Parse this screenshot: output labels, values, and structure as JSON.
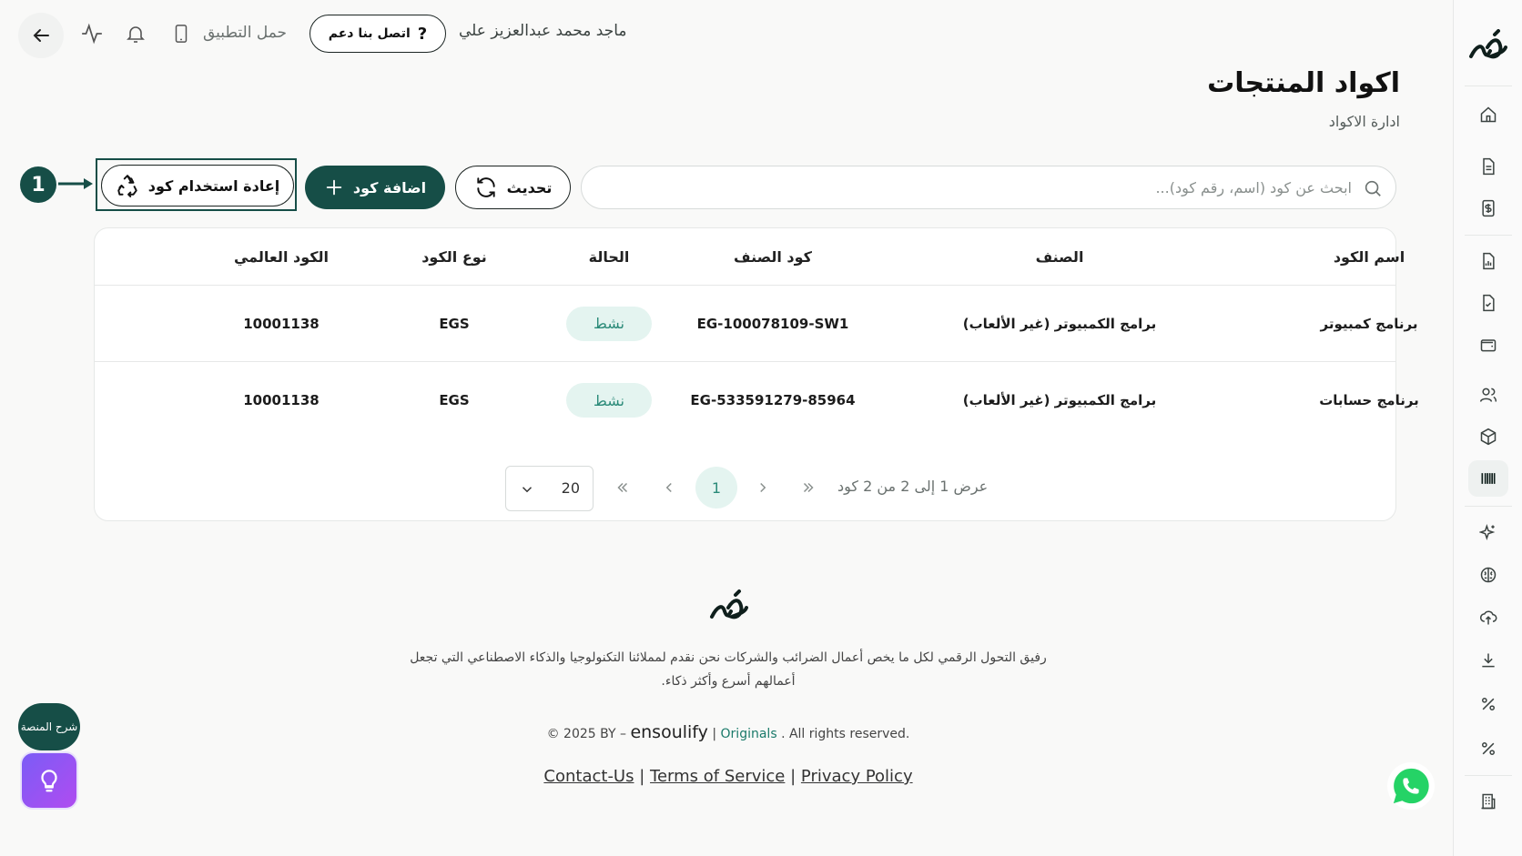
{
  "topbar": {
    "download_app": "حمل التطبيق",
    "contact_label": "اتصل بنا دعم",
    "user_name": "ماجد محمد عبدالعزيز علي"
  },
  "page": {
    "title": "اكواد المنتجات",
    "subtitle": "ادارة الاكواد"
  },
  "toolbar": {
    "search_placeholder": "ابحث عن كود (اسم، رقم كود)...",
    "refresh_label": "تحديث",
    "add_label": "اضافة كود",
    "reuse_label": "إعادة استخدام كود",
    "marker": "1"
  },
  "table": {
    "headers": {
      "name": "اسم الكود",
      "category": "الصنف",
      "category_code": "كود الصنف",
      "status": "الحالة",
      "type": "نوع الكود",
      "global": "الكود العالمي"
    },
    "rows": [
      {
        "name": "برنامج كمبيوتر",
        "category": "(برامج الكمبيوتر (غير الألعاب",
        "category_code": "EG-100078109-SW1",
        "status": "نشط",
        "type": "EGS",
        "global": "10001138"
      },
      {
        "name": "برنامج حسابات",
        "category": "(برامج الكمبيوتر (غير الألعاب",
        "category_code": "EG-533591279-85964",
        "status": "نشط",
        "type": "EGS",
        "global": "10001138"
      }
    ]
  },
  "pagination": {
    "summary": "عرض 1 إلى 2 من 2 كود",
    "current_page": "1",
    "page_size": "20"
  },
  "footer": {
    "description": "رفيق التحول الرقمي لكل ما يخص أعمال الضرائب والشركات نحن نقدم لمملائنا التكنولوجيا والذكاء الاصطناعي التي تجعل أعمالهم أسرع وأكثر ذكاء.",
    "copyright_prefix": "© 2025 BY –",
    "brand": "ensoulify",
    "originals": "Originals",
    "rights": ". All rights reserved.",
    "links": {
      "contact": "Contact-Us",
      "terms": "Terms of Service",
      "privacy": "Privacy Policy"
    }
  },
  "floating": {
    "help_label": "شرح المنصة"
  },
  "colors": {
    "brand": "#164e47",
    "badge_bg": "#e4f4f0",
    "badge_text": "#2a8a78",
    "whatsapp": "#25d366",
    "idea_gradient_start": "#7b5cf6",
    "idea_gradient_end": "#b04cf0"
  },
  "sidebar": {
    "icons": [
      "home-icon",
      "document-icon",
      "invoice-icon",
      "report-icon",
      "checklist-icon",
      "wallet-icon",
      "users-icon",
      "box-icon",
      "barcode-icon",
      "sparkle-icon",
      "brain-icon",
      "cloud-upload-icon",
      "download-icon",
      "percent-icon",
      "percent-icon",
      "building-icon"
    ],
    "active": "barcode-icon"
  }
}
